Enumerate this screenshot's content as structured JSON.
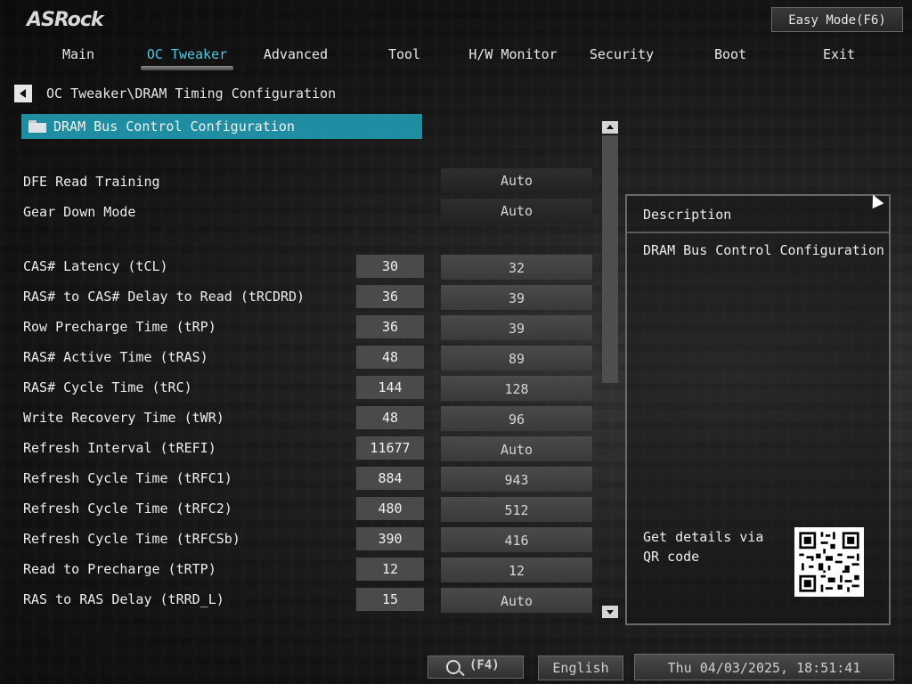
{
  "brand": "ASRock",
  "easy_mode_label": "Easy Mode(F6)",
  "nav": {
    "tabs": [
      "Main",
      "OC Tweaker",
      "Advanced",
      "Tool",
      "H/W Monitor",
      "Security",
      "Boot",
      "Exit"
    ],
    "active": "OC Tweaker"
  },
  "breadcrumb": "OC Tweaker\\DRAM Timing Configuration",
  "section_header": "DRAM Bus Control Configuration",
  "options": [
    {
      "label": "DFE Read Training",
      "setting": "Auto"
    },
    {
      "label": "Gear Down Mode",
      "setting": "Auto"
    }
  ],
  "timings": [
    {
      "label": "CAS# Latency (tCL)",
      "current": "30",
      "setting": "32"
    },
    {
      "label": "RAS# to CAS# Delay to Read  (tRCDRD)",
      "current": "36",
      "setting": "39"
    },
    {
      "label": "Row Precharge Time (tRP)",
      "current": "36",
      "setting": "39"
    },
    {
      "label": "RAS# Active Time (tRAS)",
      "current": "48",
      "setting": "89"
    },
    {
      "label": "RAS# Cycle Time (tRC)",
      "current": "144",
      "setting": "128"
    },
    {
      "label": "Write Recovery Time (tWR)",
      "current": "48",
      "setting": "96"
    },
    {
      "label": "Refresh Interval (tREFI)",
      "current": "11677",
      "setting": "Auto"
    },
    {
      "label": "Refresh Cycle Time (tRFC1)",
      "current": "884",
      "setting": "943"
    },
    {
      "label": "Refresh Cycle Time (tRFC2)",
      "current": "480",
      "setting": "512"
    },
    {
      "label": "Refresh Cycle Time (tRFCSb)",
      "current": "390",
      "setting": "416"
    },
    {
      "label": "Read to Precharge (tRTP)",
      "current": "12",
      "setting": "12"
    },
    {
      "label": "RAS to RAS Delay (tRRD_L)",
      "current": "15",
      "setting": "Auto"
    }
  ],
  "description": {
    "title": "Description",
    "text": "DRAM Bus Control Configuration",
    "qr_label": "Get details via QR code"
  },
  "footer": {
    "search_key": "(F4)",
    "language": "English",
    "datetime": "Thu 04/03/2025, 18:51:41"
  },
  "colors": {
    "accent": "#1f8ea3",
    "active_tab": "#4fc6e0"
  }
}
